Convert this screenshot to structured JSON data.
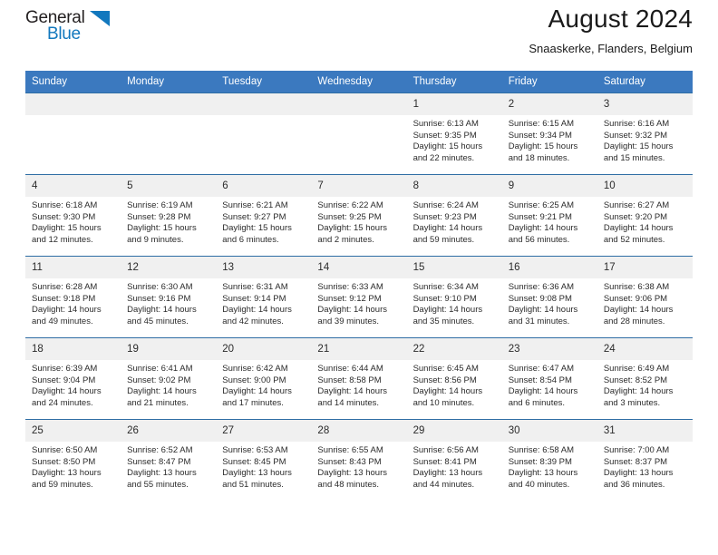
{
  "brand": {
    "name_part1": "General",
    "name_part2": "Blue",
    "logo_icon": "triangle-icon",
    "accent_color": "#1278be"
  },
  "header": {
    "title": "August 2024",
    "subtitle": "Snaaskerke, Flanders, Belgium"
  },
  "calendar": {
    "header_bg": "#3b79bf",
    "daynum_bg": "#f0f0f0",
    "row_border": "#2e6da4",
    "weekdays": [
      "Sunday",
      "Monday",
      "Tuesday",
      "Wednesday",
      "Thursday",
      "Friday",
      "Saturday"
    ],
    "weeks": [
      [
        {
          "day": "",
          "empty": true,
          "l1": "",
          "l2": "",
          "l3": "",
          "l4": ""
        },
        {
          "day": "",
          "empty": true,
          "l1": "",
          "l2": "",
          "l3": "",
          "l4": ""
        },
        {
          "day": "",
          "empty": true,
          "l1": "",
          "l2": "",
          "l3": "",
          "l4": ""
        },
        {
          "day": "",
          "empty": true,
          "l1": "",
          "l2": "",
          "l3": "",
          "l4": ""
        },
        {
          "day": "1",
          "empty": false,
          "l1": "Sunrise: 6:13 AM",
          "l2": "Sunset: 9:35 PM",
          "l3": "Daylight: 15 hours",
          "l4": "and 22 minutes."
        },
        {
          "day": "2",
          "empty": false,
          "l1": "Sunrise: 6:15 AM",
          "l2": "Sunset: 9:34 PM",
          "l3": "Daylight: 15 hours",
          "l4": "and 18 minutes."
        },
        {
          "day": "3",
          "empty": false,
          "l1": "Sunrise: 6:16 AM",
          "l2": "Sunset: 9:32 PM",
          "l3": "Daylight: 15 hours",
          "l4": "and 15 minutes."
        }
      ],
      [
        {
          "day": "4",
          "empty": false,
          "l1": "Sunrise: 6:18 AM",
          "l2": "Sunset: 9:30 PM",
          "l3": "Daylight: 15 hours",
          "l4": "and 12 minutes."
        },
        {
          "day": "5",
          "empty": false,
          "l1": "Sunrise: 6:19 AM",
          "l2": "Sunset: 9:28 PM",
          "l3": "Daylight: 15 hours",
          "l4": "and 9 minutes."
        },
        {
          "day": "6",
          "empty": false,
          "l1": "Sunrise: 6:21 AM",
          "l2": "Sunset: 9:27 PM",
          "l3": "Daylight: 15 hours",
          "l4": "and 6 minutes."
        },
        {
          "day": "7",
          "empty": false,
          "l1": "Sunrise: 6:22 AM",
          "l2": "Sunset: 9:25 PM",
          "l3": "Daylight: 15 hours",
          "l4": "and 2 minutes."
        },
        {
          "day": "8",
          "empty": false,
          "l1": "Sunrise: 6:24 AM",
          "l2": "Sunset: 9:23 PM",
          "l3": "Daylight: 14 hours",
          "l4": "and 59 minutes."
        },
        {
          "day": "9",
          "empty": false,
          "l1": "Sunrise: 6:25 AM",
          "l2": "Sunset: 9:21 PM",
          "l3": "Daylight: 14 hours",
          "l4": "and 56 minutes."
        },
        {
          "day": "10",
          "empty": false,
          "l1": "Sunrise: 6:27 AM",
          "l2": "Sunset: 9:20 PM",
          "l3": "Daylight: 14 hours",
          "l4": "and 52 minutes."
        }
      ],
      [
        {
          "day": "11",
          "empty": false,
          "l1": "Sunrise: 6:28 AM",
          "l2": "Sunset: 9:18 PM",
          "l3": "Daylight: 14 hours",
          "l4": "and 49 minutes."
        },
        {
          "day": "12",
          "empty": false,
          "l1": "Sunrise: 6:30 AM",
          "l2": "Sunset: 9:16 PM",
          "l3": "Daylight: 14 hours",
          "l4": "and 45 minutes."
        },
        {
          "day": "13",
          "empty": false,
          "l1": "Sunrise: 6:31 AM",
          "l2": "Sunset: 9:14 PM",
          "l3": "Daylight: 14 hours",
          "l4": "and 42 minutes."
        },
        {
          "day": "14",
          "empty": false,
          "l1": "Sunrise: 6:33 AM",
          "l2": "Sunset: 9:12 PM",
          "l3": "Daylight: 14 hours",
          "l4": "and 39 minutes."
        },
        {
          "day": "15",
          "empty": false,
          "l1": "Sunrise: 6:34 AM",
          "l2": "Sunset: 9:10 PM",
          "l3": "Daylight: 14 hours",
          "l4": "and 35 minutes."
        },
        {
          "day": "16",
          "empty": false,
          "l1": "Sunrise: 6:36 AM",
          "l2": "Sunset: 9:08 PM",
          "l3": "Daylight: 14 hours",
          "l4": "and 31 minutes."
        },
        {
          "day": "17",
          "empty": false,
          "l1": "Sunrise: 6:38 AM",
          "l2": "Sunset: 9:06 PM",
          "l3": "Daylight: 14 hours",
          "l4": "and 28 minutes."
        }
      ],
      [
        {
          "day": "18",
          "empty": false,
          "l1": "Sunrise: 6:39 AM",
          "l2": "Sunset: 9:04 PM",
          "l3": "Daylight: 14 hours",
          "l4": "and 24 minutes."
        },
        {
          "day": "19",
          "empty": false,
          "l1": "Sunrise: 6:41 AM",
          "l2": "Sunset: 9:02 PM",
          "l3": "Daylight: 14 hours",
          "l4": "and 21 minutes."
        },
        {
          "day": "20",
          "empty": false,
          "l1": "Sunrise: 6:42 AM",
          "l2": "Sunset: 9:00 PM",
          "l3": "Daylight: 14 hours",
          "l4": "and 17 minutes."
        },
        {
          "day": "21",
          "empty": false,
          "l1": "Sunrise: 6:44 AM",
          "l2": "Sunset: 8:58 PM",
          "l3": "Daylight: 14 hours",
          "l4": "and 14 minutes."
        },
        {
          "day": "22",
          "empty": false,
          "l1": "Sunrise: 6:45 AM",
          "l2": "Sunset: 8:56 PM",
          "l3": "Daylight: 14 hours",
          "l4": "and 10 minutes."
        },
        {
          "day": "23",
          "empty": false,
          "l1": "Sunrise: 6:47 AM",
          "l2": "Sunset: 8:54 PM",
          "l3": "Daylight: 14 hours",
          "l4": "and 6 minutes."
        },
        {
          "day": "24",
          "empty": false,
          "l1": "Sunrise: 6:49 AM",
          "l2": "Sunset: 8:52 PM",
          "l3": "Daylight: 14 hours",
          "l4": "and 3 minutes."
        }
      ],
      [
        {
          "day": "25",
          "empty": false,
          "l1": "Sunrise: 6:50 AM",
          "l2": "Sunset: 8:50 PM",
          "l3": "Daylight: 13 hours",
          "l4": "and 59 minutes."
        },
        {
          "day": "26",
          "empty": false,
          "l1": "Sunrise: 6:52 AM",
          "l2": "Sunset: 8:47 PM",
          "l3": "Daylight: 13 hours",
          "l4": "and 55 minutes."
        },
        {
          "day": "27",
          "empty": false,
          "l1": "Sunrise: 6:53 AM",
          "l2": "Sunset: 8:45 PM",
          "l3": "Daylight: 13 hours",
          "l4": "and 51 minutes."
        },
        {
          "day": "28",
          "empty": false,
          "l1": "Sunrise: 6:55 AM",
          "l2": "Sunset: 8:43 PM",
          "l3": "Daylight: 13 hours",
          "l4": "and 48 minutes."
        },
        {
          "day": "29",
          "empty": false,
          "l1": "Sunrise: 6:56 AM",
          "l2": "Sunset: 8:41 PM",
          "l3": "Daylight: 13 hours",
          "l4": "and 44 minutes."
        },
        {
          "day": "30",
          "empty": false,
          "l1": "Sunrise: 6:58 AM",
          "l2": "Sunset: 8:39 PM",
          "l3": "Daylight: 13 hours",
          "l4": "and 40 minutes."
        },
        {
          "day": "31",
          "empty": false,
          "l1": "Sunrise: 7:00 AM",
          "l2": "Sunset: 8:37 PM",
          "l3": "Daylight: 13 hours",
          "l4": "and 36 minutes."
        }
      ]
    ]
  }
}
